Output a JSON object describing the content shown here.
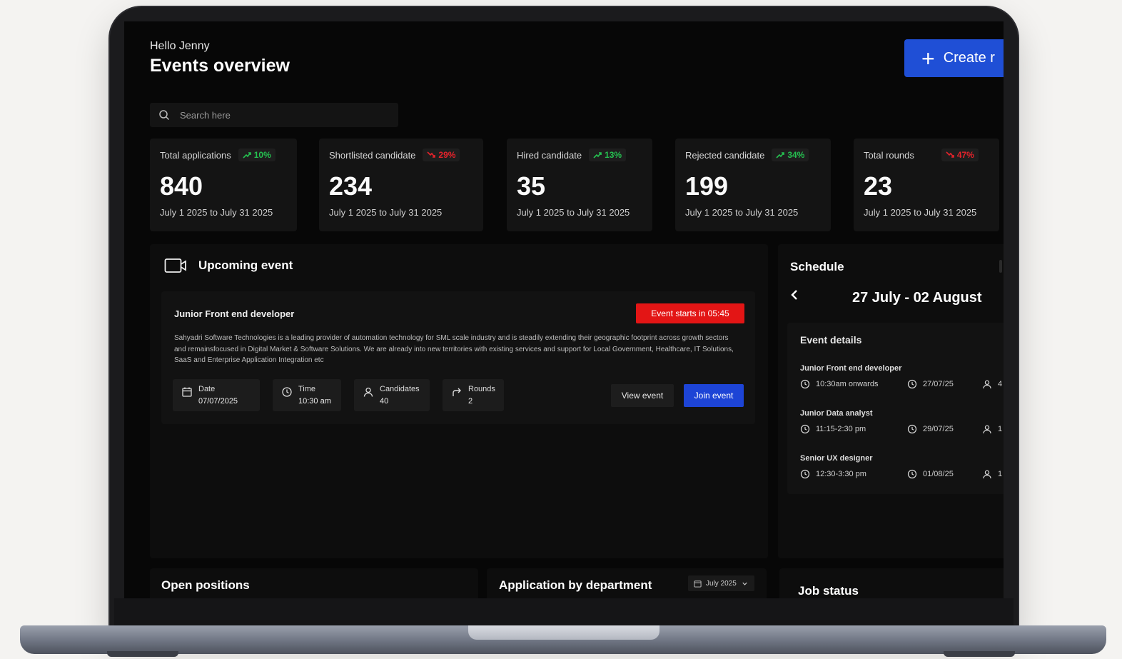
{
  "header": {
    "greeting": "Hello Jenny",
    "title": "Events overview",
    "create_label": "Create r"
  },
  "search": {
    "placeholder": "Search here"
  },
  "stats": [
    {
      "label": "Total applications",
      "trend": "10%",
      "direction": "up",
      "value": "840",
      "range": "July 1 2025 to July 31 2025"
    },
    {
      "label": "Shortlisted candidate",
      "trend": "29%",
      "direction": "down",
      "value": "234",
      "range": "July 1 2025 to July 31 2025"
    },
    {
      "label": "Hired candidate",
      "trend": "13%",
      "direction": "up",
      "value": "35",
      "range": "July 1 2025 to July 31 2025"
    },
    {
      "label": "Rejected candidate",
      "trend": "34%",
      "direction": "up",
      "value": "199",
      "range": "July 1 2025 to July 31 2025"
    },
    {
      "label": "Total rounds",
      "trend": "47%",
      "direction": "down",
      "value": "23",
      "range": "July 1 2025 to July 31 2025"
    }
  ],
  "upcoming": {
    "title": "Upcoming event",
    "icon": "video-camera-icon",
    "event": {
      "title": "Junior Front end developer",
      "timer": "Event starts in 05:45",
      "description": "Sahyadri Software Technologies is a leading provider of automation technology for SML scale industry and is steadily extending their geographic footprint across growth sectors and remainsfocused in Digital Market & Software Solutions. We are already into new territories with existing services and support for Local Government, Healthcare, IT Solutions, SaaS and Enterprise Application Integration etc",
      "date_label": "Date",
      "date_value": "07/07/2025",
      "time_label": "Time",
      "time_value": "10:30 am",
      "candidates_label": "Candidates",
      "candidates_value": "40",
      "rounds_label": "Rounds",
      "rounds_value": "2",
      "view_label": "View event",
      "join_label": "Join event"
    }
  },
  "schedule": {
    "title": "Schedule",
    "range": "27 July - 02 August",
    "details_title": "Event details",
    "items": [
      {
        "name": "Junior Front end developer",
        "time": "10:30am onwards",
        "date": "27/07/25",
        "count": "4"
      },
      {
        "name": "Junior Data analyst",
        "time": "11:15-2:30 pm",
        "date": "29/07/25",
        "count": "1"
      },
      {
        "name": "Senior UX designer",
        "time": "12:30-3:30 pm",
        "date": "01/08/25",
        "count": "1"
      }
    ]
  },
  "bottom": {
    "open_positions": "Open positions",
    "app_by_dept": "Application by department",
    "month": "July 2025",
    "job_status": "Job status"
  },
  "colors": {
    "accent": "#1f4fd6",
    "danger": "#e31515",
    "up": "#25c050",
    "down": "#e6232b"
  }
}
